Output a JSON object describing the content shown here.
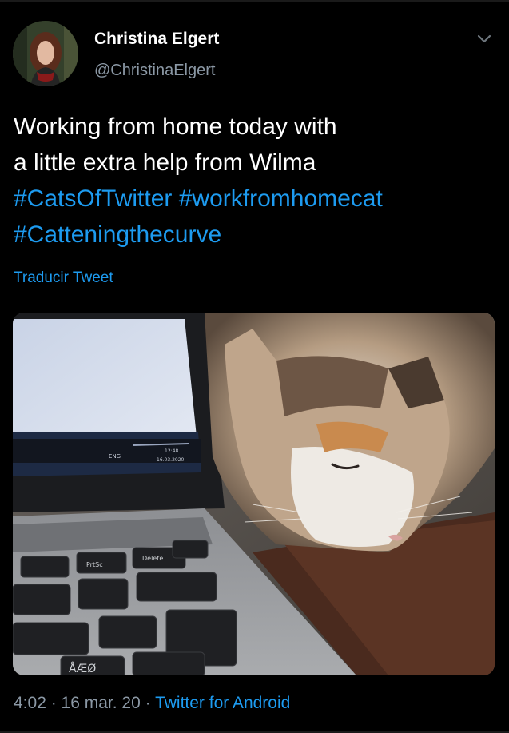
{
  "author": {
    "display_name": "Christina Elgert",
    "handle": "@ChristinaElgert"
  },
  "tweet": {
    "line1": "Working from home today with",
    "line2": "a little extra help from Wilma",
    "hashtag1": "#CatsOfTwitter",
    "hashtag2": "#workfromhomecat",
    "hashtag3": "#Catteningthecurve"
  },
  "translate_label": "Traducir Tweet",
  "meta": {
    "time": "4:02",
    "separator1": " · ",
    "date": "16 mar. 20",
    "separator2": " · ",
    "source": "Twitter for Android"
  },
  "media": {
    "description_icon": "photo",
    "keyboard_keys": [
      "PrtSc",
      "Delete",
      "ÅÆØ"
    ],
    "taskbar_lang": "ENG",
    "taskbar_time": "12:48",
    "taskbar_date": "16.03.2020"
  },
  "colors": {
    "background": "#000000",
    "link": "#1d9bf0",
    "secondary_text": "#8b98a5",
    "primary_text": "#ffffff"
  }
}
